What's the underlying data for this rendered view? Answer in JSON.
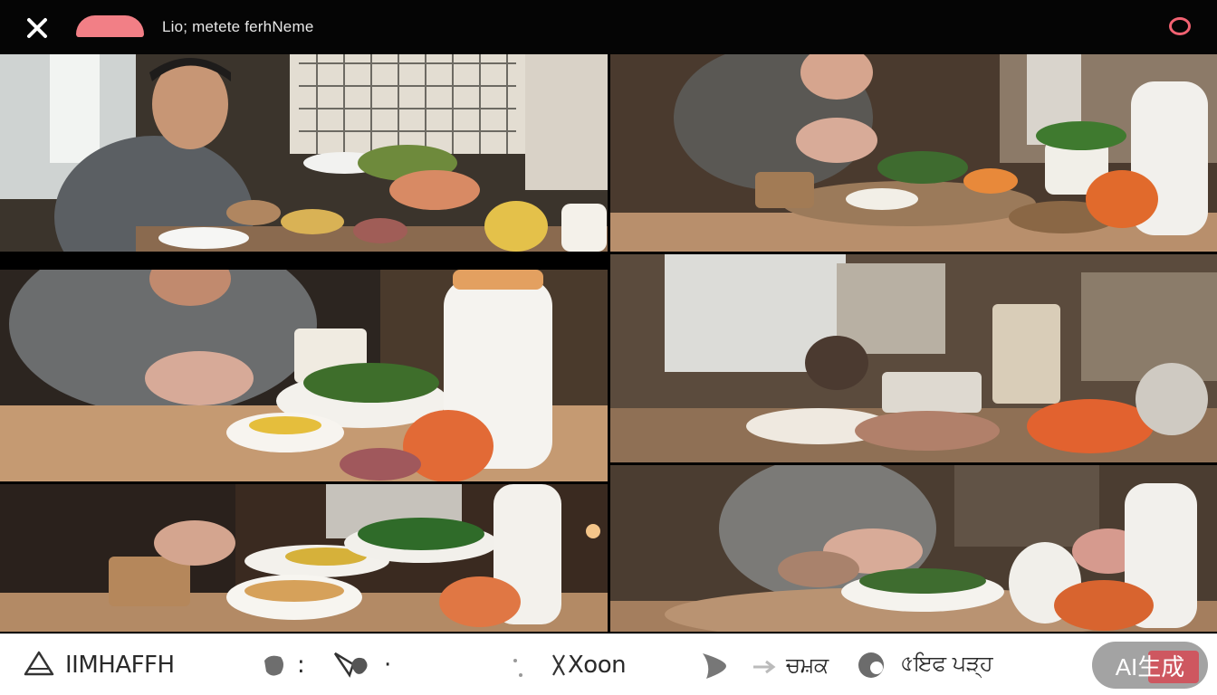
{
  "window": {
    "title": "Lio; metete ferhNeme"
  },
  "topbar": {
    "close_icon": "close-icon",
    "record_icon": "record-ring-icon",
    "accent_color": "#f27f86"
  },
  "grid": {
    "panels": [
      {
        "id": "panel-1",
        "scene": "man-at-table"
      },
      {
        "id": "panel-2",
        "scene": "hands-preparing-food"
      },
      {
        "id": "panel-3",
        "scene": "person-leaning-over-bowl"
      },
      {
        "id": "panel-4",
        "scene": "blurred-kitchen"
      },
      {
        "id": "panel-5",
        "scene": "hands-over-dishes"
      },
      {
        "id": "panel-6",
        "scene": "hands-plating-dish"
      }
    ]
  },
  "bottombar": {
    "tools": [
      {
        "icon": "triangle-icon",
        "label": "IIMHAFFH"
      },
      {
        "icon": "blob-icon",
        "label": ":"
      },
      {
        "icon": "heart-arrow-icon",
        "label": "·"
      },
      {
        "icon": "dots-icon",
        "label": "Xoon"
      },
      {
        "icon": "play-icon",
        "label": ""
      },
      {
        "icon": "arrow-icon",
        "label": "ਚਮ਼ਕ"
      },
      {
        "icon": "ring-icon",
        "label": "৫ਇਫ ਪੜ੍ਹ"
      }
    ],
    "ai_button": {
      "label": "AI生成",
      "color": "#a3a3a3",
      "accent": "#d64a55"
    }
  }
}
